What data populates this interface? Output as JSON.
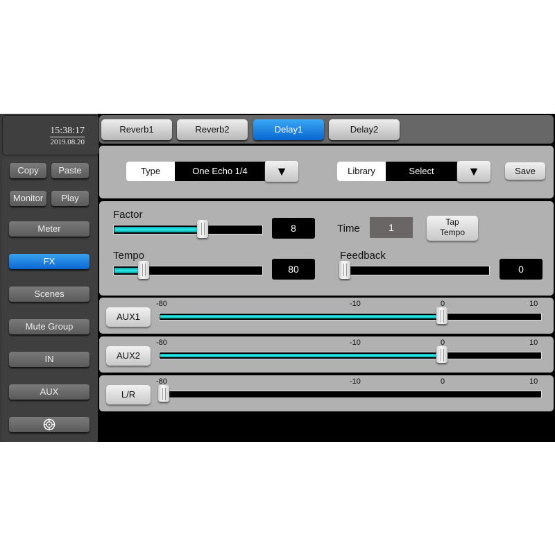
{
  "clock": {
    "time": "15:38:17",
    "date": "2019.08.20"
  },
  "sidebar": {
    "copy": "Copy",
    "paste": "Paste",
    "monitor": "Monitor",
    "play": "Play",
    "items": [
      {
        "label": "Meter",
        "active": false
      },
      {
        "label": "FX",
        "active": true
      },
      {
        "label": "Scenes",
        "active": false
      },
      {
        "label": "Mute Group",
        "active": false
      },
      {
        "label": "IN",
        "active": false
      },
      {
        "label": "AUX",
        "active": false
      }
    ],
    "settings_icon": "target-icon"
  },
  "tabs": [
    {
      "label": "Reverb1",
      "active": false
    },
    {
      "label": "Reverb2",
      "active": false
    },
    {
      "label": "Delay1",
      "active": true
    },
    {
      "label": "Delay2",
      "active": false
    }
  ],
  "type_select": {
    "label": "Type",
    "value": "One Echo 1/4",
    "dropdown_icon": "triangle-down-icon"
  },
  "library_select": {
    "label": "Library",
    "value": "Select",
    "dropdown_icon": "triangle-down-icon"
  },
  "save_label": "Save",
  "params": {
    "factor": {
      "label": "Factor",
      "value": "8",
      "fraction": 0.6
    },
    "tempo": {
      "label": "Tempo",
      "value": "80",
      "fraction": 0.2
    },
    "time": {
      "label": "Time",
      "value": "1"
    },
    "tap_tempo": "Tap\nTempo",
    "feedback": {
      "label": "Feedback",
      "value": "0",
      "fraction": 0.0
    }
  },
  "sends": {
    "scale": [
      "-80",
      "-10",
      "0",
      "10"
    ],
    "channels": [
      {
        "label": "AUX1",
        "level_db": 0,
        "fraction": 0.74
      },
      {
        "label": "AUX2",
        "level_db": 0,
        "fraction": 0.74
      },
      {
        "label": "L/R",
        "level_db": -80,
        "fraction": 0.0
      }
    ]
  },
  "colors": {
    "accent": "#0a72dc",
    "fill": "#1fd6d6",
    "panel": "#b1b1b1"
  }
}
